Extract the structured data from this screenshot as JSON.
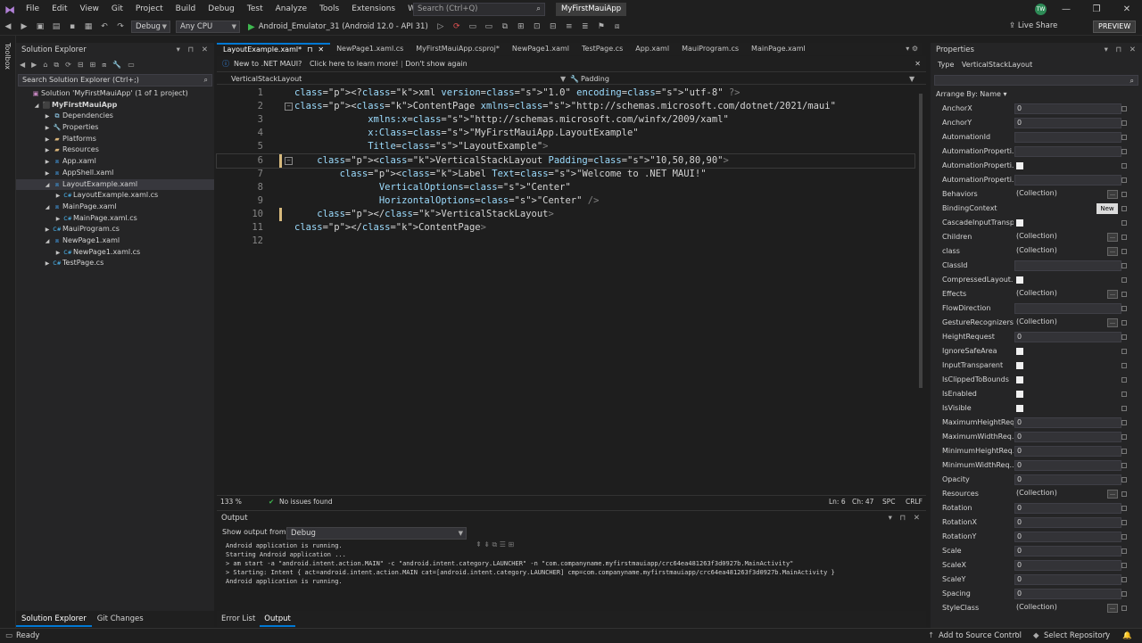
{
  "menubar": {
    "items": [
      "File",
      "Edit",
      "View",
      "Git",
      "Project",
      "Build",
      "Debug",
      "Test",
      "Analyze",
      "Tools",
      "Extensions",
      "Window",
      "Help"
    ],
    "search_placeholder": "Search (Ctrl+Q)",
    "project_badge": "MyFirstMauiApp",
    "avatar": "TW"
  },
  "toolbar": {
    "config": "Debug",
    "platform": "Any CPU",
    "run_target": "Android_Emulator_31 (Android 12.0 - API 31)",
    "live_share": "Live Share",
    "preview": "PREVIEW"
  },
  "toolbox_label": "Toolbox",
  "solution_explorer": {
    "title": "Solution Explorer",
    "search_placeholder": "Search Solution Explorer (Ctrl+;)",
    "tree": [
      {
        "label": "Solution 'MyFirstMauiApp' (1 of 1 project)",
        "depth": 0,
        "arrow": "",
        "icon": "solution"
      },
      {
        "label": "MyFirstMauiApp",
        "depth": 1,
        "arrow": "◢",
        "icon": "project",
        "bold": true
      },
      {
        "label": "Dependencies",
        "depth": 2,
        "arrow": "▶",
        "icon": "deps"
      },
      {
        "label": "Properties",
        "depth": 2,
        "arrow": "▶",
        "icon": "wrench"
      },
      {
        "label": "Platforms",
        "depth": 2,
        "arrow": "▶",
        "icon": "folder"
      },
      {
        "label": "Resources",
        "depth": 2,
        "arrow": "▶",
        "icon": "folder"
      },
      {
        "label": "App.xaml",
        "depth": 2,
        "arrow": "▶",
        "icon": "xaml"
      },
      {
        "label": "AppShell.xaml",
        "depth": 2,
        "arrow": "▶",
        "icon": "xaml"
      },
      {
        "label": "LayoutExample.xaml",
        "depth": 2,
        "arrow": "◢",
        "icon": "xaml",
        "selected": true
      },
      {
        "label": "LayoutExample.xaml.cs",
        "depth": 3,
        "arrow": "▶",
        "icon": "cs"
      },
      {
        "label": "MainPage.xaml",
        "depth": 2,
        "arrow": "◢",
        "icon": "xaml"
      },
      {
        "label": "MainPage.xaml.cs",
        "depth": 3,
        "arrow": "▶",
        "icon": "cs"
      },
      {
        "label": "MauiProgram.cs",
        "depth": 2,
        "arrow": "▶",
        "icon": "cs"
      },
      {
        "label": "NewPage1.xaml",
        "depth": 2,
        "arrow": "◢",
        "icon": "xaml"
      },
      {
        "label": "NewPage1.xaml.cs",
        "depth": 3,
        "arrow": "▶",
        "icon": "cs"
      },
      {
        "label": "TestPage.cs",
        "depth": 2,
        "arrow": "▶",
        "icon": "cs"
      }
    ],
    "bottom_tabs": [
      "Solution Explorer",
      "Git Changes"
    ]
  },
  "doc_tabs": [
    {
      "label": "LayoutExample.xaml*",
      "active": true
    },
    {
      "label": "NewPage1.xaml.cs"
    },
    {
      "label": "MyFirstMauiApp.csproj*"
    },
    {
      "label": "NewPage1.xaml"
    },
    {
      "label": "TestPage.cs"
    },
    {
      "label": "App.xaml"
    },
    {
      "label": "MauiProgram.cs"
    },
    {
      "label": "MainPage.xaml"
    }
  ],
  "info_bar": {
    "text": "New to .NET MAUI?",
    "link1": "Click here to learn more!",
    "link2": "Don't show again"
  },
  "nav_bar": {
    "left": "VerticalStackLayout",
    "right": "Padding"
  },
  "editor": {
    "lines": [
      {
        "n": "1",
        "t": "<?xml version=\"1.0\" encoding=\"utf-8\" ?>"
      },
      {
        "n": "2",
        "t": "<ContentPage xmlns=\"http://schemas.microsoft.com/dotnet/2021/maui\""
      },
      {
        "n": "3",
        "t": "             xmlns:x=\"http://schemas.microsoft.com/winfx/2009/xaml\""
      },
      {
        "n": "4",
        "t": "             x:Class=\"MyFirstMauiApp.LayoutExample\""
      },
      {
        "n": "5",
        "t": "             Title=\"LayoutExample\">"
      },
      {
        "n": "6",
        "t": "    <VerticalStackLayout Padding=\"10,50,80,90\">"
      },
      {
        "n": "7",
        "t": "        <Label Text=\"Welcome to .NET MAUI!\""
      },
      {
        "n": "8",
        "t": "               VerticalOptions=\"Center\""
      },
      {
        "n": "9",
        "t": "               HorizontalOptions=\"Center\" />"
      },
      {
        "n": "10",
        "t": "    </VerticalStackLayout>"
      },
      {
        "n": "11",
        "t": "</ContentPage>"
      },
      {
        "n": "12",
        "t": ""
      }
    ]
  },
  "editor_status": {
    "zoom": "133 %",
    "issues": "No issues found",
    "ln": "Ln: 6",
    "ch": "Ch: 47",
    "spc": "SPC",
    "crlf": "CRLF"
  },
  "output": {
    "title": "Output",
    "show_from_label": "Show output from:",
    "show_from_value": "Debug",
    "lines": [
      "Android application is running.",
      "Starting Android application ...",
      "> am start -a \"android.intent.action.MAIN\" -c \"android.intent.category.LAUNCHER\" -n \"com.companyname.myfirstmauiapp/crc64ea481263f3d0927b.MainActivity\"",
      "> Starting: Intent { act=android.intent.action.MAIN cat=[android.intent.category.LAUNCHER] cmp=com.companyname.myfirstmauiapp/crc64ea481263f3d0927b.MainActivity }",
      "",
      "Android application is running."
    ],
    "bottom_tabs": [
      "Error List",
      "Output"
    ]
  },
  "properties": {
    "title": "Properties",
    "type_label": "Type",
    "type_value": "VerticalStackLayout",
    "arrange": "Arrange By: Name",
    "rows": [
      {
        "name": "AnchorX",
        "kind": "text",
        "value": "0"
      },
      {
        "name": "AnchorY",
        "kind": "text",
        "value": "0"
      },
      {
        "name": "AutomationId",
        "kind": "text",
        "value": ""
      },
      {
        "name": "AutomationProperti...",
        "kind": "text",
        "value": ""
      },
      {
        "name": "AutomationProperti...",
        "kind": "check",
        "value": ""
      },
      {
        "name": "AutomationProperti...",
        "kind": "text",
        "value": ""
      },
      {
        "name": "Behaviors",
        "kind": "coll",
        "value": "(Collection)"
      },
      {
        "name": "BindingContext",
        "kind": "new",
        "value": "New"
      },
      {
        "name": "CascadeInputTransp...",
        "kind": "check",
        "value": ""
      },
      {
        "name": "Children",
        "kind": "coll",
        "value": "(Collection)"
      },
      {
        "name": "class",
        "kind": "coll",
        "value": "(Collection)"
      },
      {
        "name": "ClassId",
        "kind": "text",
        "value": ""
      },
      {
        "name": "CompressedLayout.I...",
        "kind": "check",
        "value": ""
      },
      {
        "name": "Effects",
        "kind": "coll",
        "value": "(Collection)"
      },
      {
        "name": "FlowDirection",
        "kind": "text",
        "value": ""
      },
      {
        "name": "GestureRecognizers",
        "kind": "coll",
        "value": "(Collection)"
      },
      {
        "name": "HeightRequest",
        "kind": "text",
        "value": "0"
      },
      {
        "name": "IgnoreSafeArea",
        "kind": "check",
        "value": ""
      },
      {
        "name": "InputTransparent",
        "kind": "check",
        "value": ""
      },
      {
        "name": "IsClippedToBounds",
        "kind": "check",
        "value": ""
      },
      {
        "name": "IsEnabled",
        "kind": "check",
        "value": ""
      },
      {
        "name": "IsVisible",
        "kind": "check",
        "value": ""
      },
      {
        "name": "MaximumHeightReq...",
        "kind": "text",
        "value": "0"
      },
      {
        "name": "MaximumWidthReq...",
        "kind": "text",
        "value": "0"
      },
      {
        "name": "MinimumHeightReq...",
        "kind": "text",
        "value": "0"
      },
      {
        "name": "MinimumWidthReq...",
        "kind": "text",
        "value": "0"
      },
      {
        "name": "Opacity",
        "kind": "text",
        "value": "0"
      },
      {
        "name": "Resources",
        "kind": "coll",
        "value": "(Collection)"
      },
      {
        "name": "Rotation",
        "kind": "text",
        "value": "0"
      },
      {
        "name": "RotationX",
        "kind": "text",
        "value": "0"
      },
      {
        "name": "RotationY",
        "kind": "text",
        "value": "0"
      },
      {
        "name": "Scale",
        "kind": "text",
        "value": "0"
      },
      {
        "name": "ScaleX",
        "kind": "text",
        "value": "0"
      },
      {
        "name": "ScaleY",
        "kind": "text",
        "value": "0"
      },
      {
        "name": "Spacing",
        "kind": "text",
        "value": "0"
      },
      {
        "name": "StyleClass",
        "kind": "coll",
        "value": "(Collection)"
      }
    ]
  },
  "statusbar": {
    "left": "Ready",
    "add_source": "Add to Source Control",
    "select_repo": "Select Repository"
  }
}
